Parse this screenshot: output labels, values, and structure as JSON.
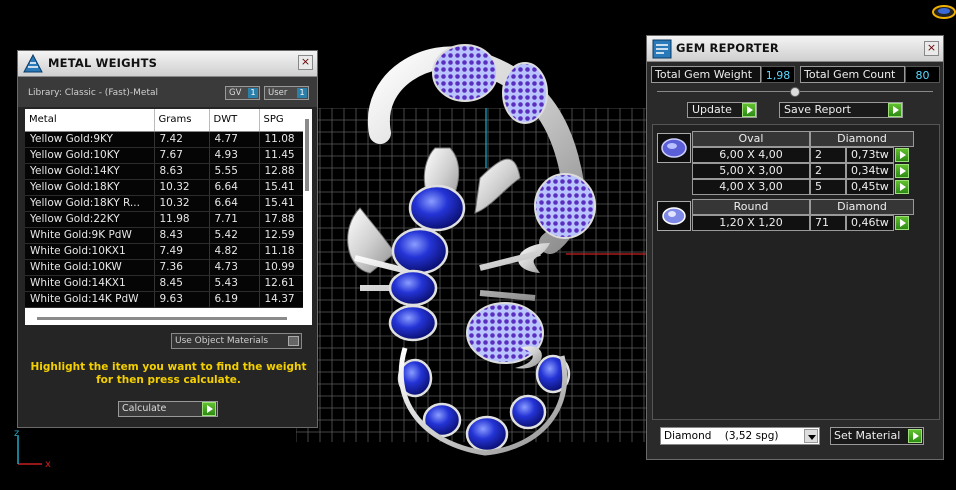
{
  "colors": {
    "accent_green": "#3fa51f",
    "gem_blue": "#1e2ec8",
    "metal_white": "#d8d8d8",
    "hint_yellow": "#f5d000",
    "value_cyan": "#5ad9ff"
  },
  "metal_weights": {
    "title": "METAL WEIGHTS",
    "library_label": "Library: Classic - (Fast)-Metal",
    "gv_label": "GV",
    "gv_value": "1",
    "user_label": "User",
    "user_value": "1",
    "columns": [
      "Metal",
      "Grams",
      "DWT",
      "SPG"
    ],
    "rows": [
      [
        "Yellow Gold:9KY",
        "7.42",
        "4.77",
        "11.08"
      ],
      [
        "Yellow Gold:10KY",
        "7.67",
        "4.93",
        "11.45"
      ],
      [
        "Yellow Gold:14KY",
        "8.63",
        "5.55",
        "12.88"
      ],
      [
        "Yellow Gold:18KY",
        "10.32",
        "6.64",
        "15.41"
      ],
      [
        "Yellow Gold:18KY R...",
        "10.32",
        "6.64",
        "15.41"
      ],
      [
        "Yellow Gold:22KY",
        "11.98",
        "7.71",
        "17.88"
      ],
      [
        "White Gold:9K PdW",
        "8.43",
        "5.42",
        "12.59"
      ],
      [
        "White Gold:10KX1",
        "7.49",
        "4.82",
        "11.18"
      ],
      [
        "White Gold:10KW",
        "7.36",
        "4.73",
        "10.99"
      ],
      [
        "White Gold:14KX1",
        "8.45",
        "5.43",
        "12.61"
      ],
      [
        "White Gold:14K PdW",
        "9.63",
        "6.19",
        "14.37"
      ]
    ],
    "use_object_materials": "Use Object Materials",
    "hint": "Highlight the item you want to find the weight for then press calculate.",
    "calculate_label": "Calculate"
  },
  "gem_reporter": {
    "title": "GEM REPORTER",
    "total_weight_label": "Total Gem Weight",
    "total_weight_value": "1,98",
    "total_count_label": "Total Gem Count",
    "total_count_value": "80",
    "update_label": "Update",
    "save_report_label": "Save Report",
    "groups": [
      {
        "shape": "Oval",
        "material": "Diamond",
        "icon": "oval-gem-icon",
        "rows": [
          [
            "6,00 X 4,00",
            "2",
            "0,73tw"
          ],
          [
            "5,00 X 3,00",
            "2",
            "0,34tw"
          ],
          [
            "4,00 X 3,00",
            "5",
            "0,45tw"
          ]
        ]
      },
      {
        "shape": "Round",
        "material": "Diamond",
        "icon": "round-gem-icon",
        "rows": [
          [
            "1,20 X 1,20",
            "71",
            "0,46tw"
          ]
        ]
      }
    ],
    "material_select": "Diamond    (3,52 spg)",
    "set_material_label": "Set Material"
  },
  "axis": {
    "x_label": "x",
    "z_label": "z"
  }
}
